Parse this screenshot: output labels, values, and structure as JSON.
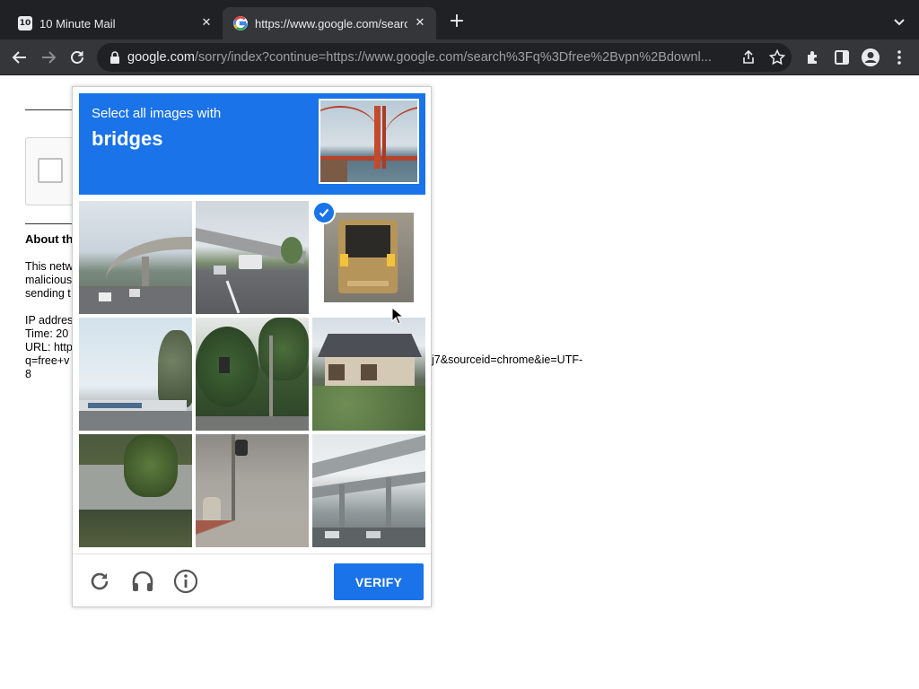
{
  "browser": {
    "tabs": [
      {
        "label": "10 Minute Mail",
        "favicon": "10"
      },
      {
        "label": "https://www.google.com/search",
        "favicon": "google-icon"
      }
    ],
    "url_host": "google.com",
    "url_rest": "/sorry/index?continue=https://www.google.com/search%3Fq%3Dfree%2Bvpn%2Bdownl..."
  },
  "page": {
    "about_heading": "About th",
    "para1": "This netw\nmalicious\nsending t",
    "para2": "IP addres\nTime: 20\nURL: http\nq=free+v\n8",
    "url_tail": "j7&sourceid=chrome&ie=UTF-"
  },
  "challenge": {
    "prompt": "Select all images with",
    "target": "bridges",
    "verify_label": "VERIFY",
    "accent": "#1a73e8",
    "tiles": [
      {
        "scene": "curved-overpass",
        "selected": false
      },
      {
        "scene": "highway-overpass",
        "selected": false
      },
      {
        "scene": "vehicle-rear",
        "selected": true
      },
      {
        "scene": "palm-tree-station",
        "selected": false
      },
      {
        "scene": "trees-traffic-light",
        "selected": false
      },
      {
        "scene": "japanese-house",
        "selected": false
      },
      {
        "scene": "garden-palm",
        "selected": false
      },
      {
        "scene": "street-corner",
        "selected": false
      },
      {
        "scene": "elevated-railway",
        "selected": false
      }
    ]
  }
}
